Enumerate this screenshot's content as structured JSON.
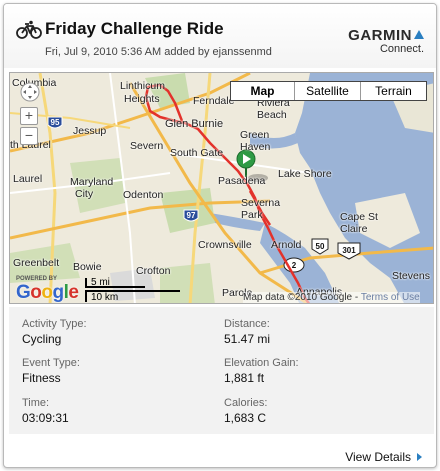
{
  "header": {
    "title": "Friday Challenge Ride",
    "subtitle": "Fri, Jul 9, 2010 5:36 AM added by ejanssenmd",
    "brand_name": "GARMIN",
    "brand_sub": "Connect.",
    "icon": "bicycle-icon",
    "brand_color": "#2a7fc1"
  },
  "map": {
    "types": [
      "Map",
      "Satellite",
      "Terrain"
    ],
    "active_type": "Map",
    "zoom_in_label": "+",
    "zoom_out_label": "−",
    "places": {
      "columbia": "Columbia",
      "linthicum": "Linthicum",
      "heights": "Heights",
      "ferndale": "Ferndale",
      "riviera": "Riviera",
      "beach": "Beach",
      "jessup": "Jessup",
      "glen_burnie": "Glen Burnie",
      "north_laurel": "th Laurel",
      "severn": "Severn",
      "south_gate": "South Gate",
      "green": "Green",
      "haven": "Haven",
      "laurel": "Laurel",
      "maryland": "Maryland",
      "city": "City",
      "pasadena": "Pasadena",
      "lake_shore": "Lake Shore",
      "odenton": "Odenton",
      "severna": "Severna",
      "park": "Park",
      "cape_st": "Cape St",
      "claire": "Claire",
      "crownsville": "Crownsville",
      "arnold": "Arnold",
      "greenbelt": "Greenbelt",
      "bowie": "Bowie",
      "crofton": "Crofton",
      "stevensville": "Stevens",
      "parole": "Parole",
      "annapolis": "Annapolis"
    },
    "shields": {
      "i95": "95",
      "i97": "97",
      "us50": "50",
      "us301": "301",
      "r2": "2"
    },
    "scale_mi": "5 mi",
    "scale_km": "10 km",
    "logo_powered": "POWERED BY",
    "logo_letters": [
      "G",
      "o",
      "o",
      "g",
      "l",
      "e"
    ],
    "attribution": "Map data ©2010 Google -",
    "terms": "Terms of Use",
    "route_color": "#e3322b",
    "water_color": "#9bb3d6",
    "land_color": "#eeeadc"
  },
  "stats": {
    "activity_type": {
      "label": "Activity Type:",
      "value": "Cycling"
    },
    "distance": {
      "label": "Distance:",
      "value": "51.47 mi"
    },
    "event_type": {
      "label": "Event Type:",
      "value": "Fitness"
    },
    "elevation_gain": {
      "label": "Elevation Gain:",
      "value": "1,881 ft"
    },
    "time": {
      "label": "Time:",
      "value": "03:09:31"
    },
    "calories": {
      "label": "Calories:",
      "value": "1,683 C"
    }
  },
  "footer": {
    "view_details": "View Details"
  }
}
